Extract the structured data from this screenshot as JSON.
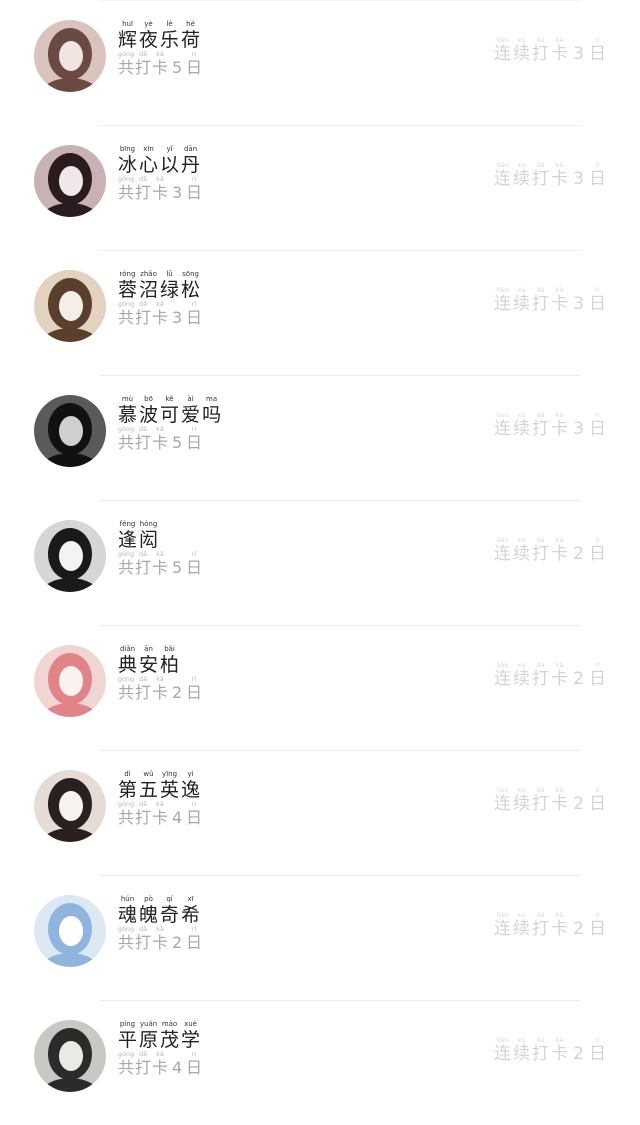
{
  "streak_prefix": [
    {
      "han": "连",
      "py": "lián"
    },
    {
      "han": "续",
      "py": "xù"
    },
    {
      "han": "打",
      "py": "dǎ"
    },
    {
      "han": "卡",
      "py": "kǎ"
    }
  ],
  "total_prefix": [
    {
      "han": "共",
      "py": "gòng"
    },
    {
      "han": "打",
      "py": "dǎ"
    },
    {
      "han": "卡",
      "py": "kǎ"
    }
  ],
  "day_unit": {
    "han": "日",
    "py": "rì"
  },
  "users": [
    {
      "name": [
        {
          "han": "辉",
          "py": "huī"
        },
        {
          "han": "夜",
          "py": "yè"
        },
        {
          "han": "乐",
          "py": "lè"
        },
        {
          "han": "荷",
          "py": "hé"
        }
      ],
      "total_days": "5",
      "streak_days": "3",
      "avatar_colors": [
        "#d9c3bd",
        "#6b4a44",
        "#efe4e0"
      ]
    },
    {
      "name": [
        {
          "han": "冰",
          "py": "bīng"
        },
        {
          "han": "心",
          "py": "xīn"
        },
        {
          "han": "以",
          "py": "yǐ"
        },
        {
          "han": "丹",
          "py": "dān"
        }
      ],
      "total_days": "3",
      "streak_days": "3",
      "avatar_colors": [
        "#c9b2b4",
        "#2a1c1e",
        "#f1e6ea"
      ]
    },
    {
      "name": [
        {
          "han": "蓉",
          "py": "róng"
        },
        {
          "han": "沼",
          "py": "zhǎo"
        },
        {
          "han": "绿",
          "py": "lǜ"
        },
        {
          "han": "松",
          "py": "sōng"
        }
      ],
      "total_days": "3",
      "streak_days": "3",
      "avatar_colors": [
        "#e4d2c0",
        "#5a3f2c",
        "#f5eee6"
      ]
    },
    {
      "name": [
        {
          "han": "慕",
          "py": "mù"
        },
        {
          "han": "波",
          "py": "bō"
        },
        {
          "han": "可",
          "py": "kě"
        },
        {
          "han": "爱",
          "py": "ài"
        },
        {
          "han": "吗",
          "py": "ma"
        }
      ],
      "total_days": "5",
      "streak_days": "3",
      "avatar_colors": [
        "#5a5a5a",
        "#111111",
        "#cfcfcf"
      ]
    },
    {
      "name": [
        {
          "han": "逢",
          "py": "féng"
        },
        {
          "han": "闳",
          "py": "hóng"
        }
      ],
      "total_days": "5",
      "streak_days": "2",
      "avatar_colors": [
        "#d6d6d6",
        "#1a1a1a",
        "#f3f3f3"
      ]
    },
    {
      "name": [
        {
          "han": "典",
          "py": "diǎn"
        },
        {
          "han": "安",
          "py": "ān"
        },
        {
          "han": "柏",
          "py": "bǎi"
        }
      ],
      "total_days": "2",
      "streak_days": "2",
      "avatar_colors": [
        "#f1d5d2",
        "#e0848a",
        "#fbf1ef"
      ]
    },
    {
      "name": [
        {
          "han": "第",
          "py": "dì"
        },
        {
          "han": "五",
          "py": "wǔ"
        },
        {
          "han": "英",
          "py": "yīng"
        },
        {
          "han": "逸",
          "py": "yì"
        }
      ],
      "total_days": "4",
      "streak_days": "2",
      "avatar_colors": [
        "#e6dcd6",
        "#2a2020",
        "#f6f2ef"
      ]
    },
    {
      "name": [
        {
          "han": "魂",
          "py": "hún"
        },
        {
          "han": "魄",
          "py": "pò"
        },
        {
          "han": "奇",
          "py": "qí"
        },
        {
          "han": "希",
          "py": "xī"
        }
      ],
      "total_days": "2",
      "streak_days": "2",
      "avatar_colors": [
        "#dce9f5",
        "#8fb5dd",
        "#ffffff"
      ]
    },
    {
      "name": [
        {
          "han": "平",
          "py": "píng"
        },
        {
          "han": "原",
          "py": "yuán"
        },
        {
          "han": "茂",
          "py": "mào"
        },
        {
          "han": "学",
          "py": "xué"
        }
      ],
      "total_days": "4",
      "streak_days": "2",
      "avatar_colors": [
        "#c8c8c4",
        "#2b2b2b",
        "#e9e9e6"
      ]
    }
  ]
}
